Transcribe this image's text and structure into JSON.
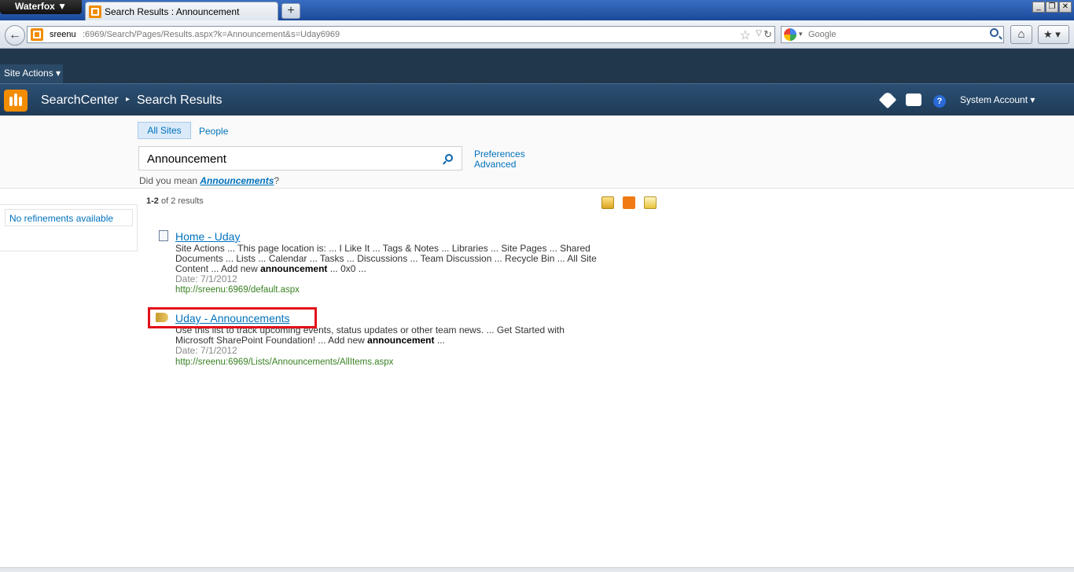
{
  "browser": {
    "app_menu": "Waterfox ▼",
    "tab_title": "Search Results : Announcement",
    "new_tab": "+",
    "url_host": "sreenu",
    "url_path": ":6969/Search/Pages/Results.aspx?k=Announcement&s=Uday6969",
    "search_placeholder": "Google"
  },
  "sharepoint": {
    "site_actions": "Site Actions ▾",
    "breadcrumb_site": "SearchCenter",
    "breadcrumb_page": "Search Results",
    "account": "System Account ▾",
    "help": "?"
  },
  "search": {
    "scopes": [
      "All Sites",
      "People"
    ],
    "query": "Announcement",
    "preferences_link": "Preferences",
    "advanced_link": "Advanced",
    "did_you_mean_prefix": "Did you mean ",
    "did_you_mean_suggestion": "Announcements",
    "did_you_mean_suffix": "?"
  },
  "refinement": {
    "text": "No refinements available"
  },
  "results_summary": {
    "range": "1-2",
    "of_text": " of 2 results"
  },
  "results": [
    {
      "title": "Home - Uday",
      "snippet_line1": "Site Actions ... This page location is: ... I Like It ... Tags & Notes ... Libraries ... Site Pages ... Shared",
      "snippet_line2": "Documents ... Lists ... Calendar ... Tasks ... Discussions ... Team Discussion ... Recycle Bin ... All Site",
      "snippet_line3_prefix": "Content ... Add new ",
      "snippet_line3_bold": "announcement",
      "snippet_line3_suffix": " ... 0x0 ...",
      "date": "Date: 7/1/2012",
      "url": "http://sreenu:6969/default.aspx"
    },
    {
      "title": "Uday - Announcements",
      "snippet_line1": "Use this list to track upcoming events, status updates or other team news. ... Get Started with",
      "snippet_line2_prefix": "Microsoft SharePoint Foundation! ... Add new ",
      "snippet_line2_bold": "announcement",
      "snippet_line2_suffix": " ...",
      "date": "Date: 7/1/2012",
      "url": "http://sreenu:6969/Lists/Announcements/AllItems.aspx"
    }
  ],
  "colors": {
    "link": "#0072bc",
    "url_green": "#388222",
    "highlight": "#e3101a"
  }
}
